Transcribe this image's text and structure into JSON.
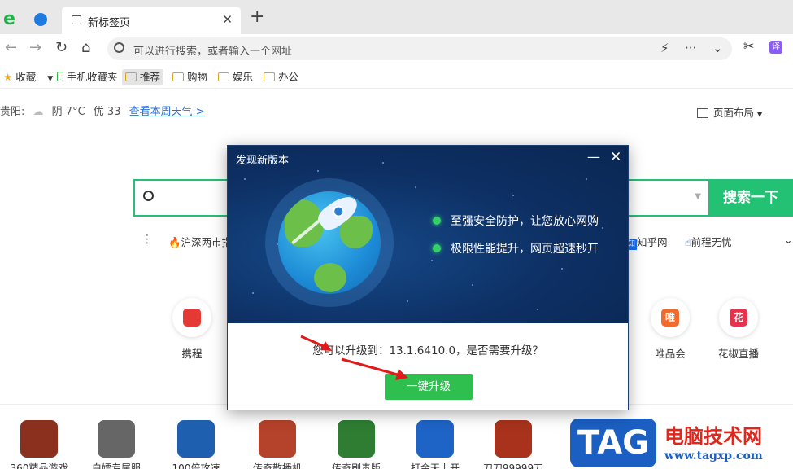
{
  "tab": {
    "title": "新标签页",
    "close": "✕",
    "new": "+"
  },
  "address": {
    "placeholder": "可以进行搜索，或者输入一个网址",
    "ext_badge": "译"
  },
  "bookmarks": {
    "favorites": "收藏",
    "mobile": "手机收藏夹",
    "items": [
      "推荐",
      "购物",
      "娱乐",
      "办公"
    ]
  },
  "weather": {
    "city": "贵阳:",
    "condition": "阴 7°C",
    "aqi": "优 33",
    "link": "查看本周天气 >"
  },
  "page_layout": "页面布局",
  "search": {
    "button": "搜索一下"
  },
  "hot": {
    "left": "沪深两市指",
    "right": [
      "知乎网",
      "前程无忧"
    ]
  },
  "sites": [
    {
      "label": "携程",
      "glyph": "",
      "color": "#e53935"
    },
    {
      "label": "唯品会",
      "glyph": "唯",
      "color": "#f26b2c"
    },
    {
      "label": "花椒直播",
      "glyph": "花",
      "color": "#e5334d"
    }
  ],
  "games": [
    {
      "label": "360精品游戏",
      "color": "#8b2f1f"
    },
    {
      "label": "白嫖专属服",
      "color": "#666666"
    },
    {
      "label": "100倍攻速",
      "color": "#1f5fb0"
    },
    {
      "label": "传奇散播机",
      "color": "#b5422b"
    },
    {
      "label": "传奇刷毒版",
      "color": "#2e7d32"
    },
    {
      "label": "打金天上开",
      "color": "#1e63c6"
    },
    {
      "label": "刀刀99999刀",
      "color": "#a8321b"
    }
  ],
  "dialog": {
    "title": "发现新版本",
    "min": "—",
    "close": "✕",
    "features": [
      "至强安全防护，让您放心网购",
      "极限性能提升，网页超速秒开"
    ],
    "message": "您可以升级到：13.1.6410.0，是否需要升级？",
    "button": "一键升级"
  },
  "watermark": {
    "tag": "TAG",
    "cn": "电脑技术网",
    "url": "www.tagxp.com"
  }
}
